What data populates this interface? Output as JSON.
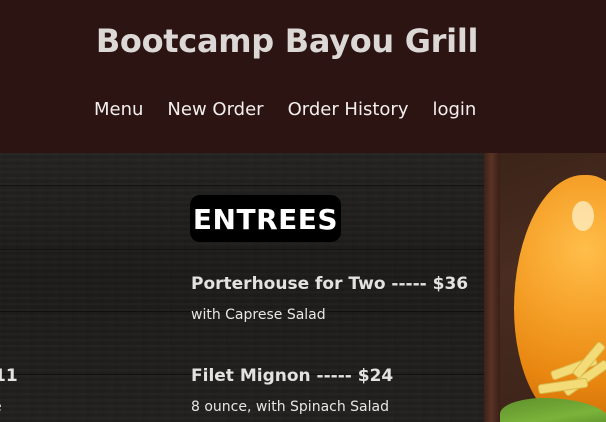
{
  "header": {
    "title": "Bootcamp Bayou Grill",
    "nav": [
      "Menu",
      "New Order",
      "Order History",
      "login"
    ]
  },
  "menu": {
    "section_title": "ENTREES",
    "items": [
      {
        "title": "Porterhouse for Two ----- $36",
        "desc": "with Caprese Salad"
      },
      {
        "title": "Filet Mignon ----- $24",
        "desc": "8 ounce, with Spinach Salad"
      }
    ],
    "left_column_fragments": {
      "price_tail": "11",
      "desc_tail": "e"
    }
  },
  "colors": {
    "header_bg": "#2c1413",
    "board_bg": "#1d1b1a",
    "badge_bg": "#000000"
  }
}
